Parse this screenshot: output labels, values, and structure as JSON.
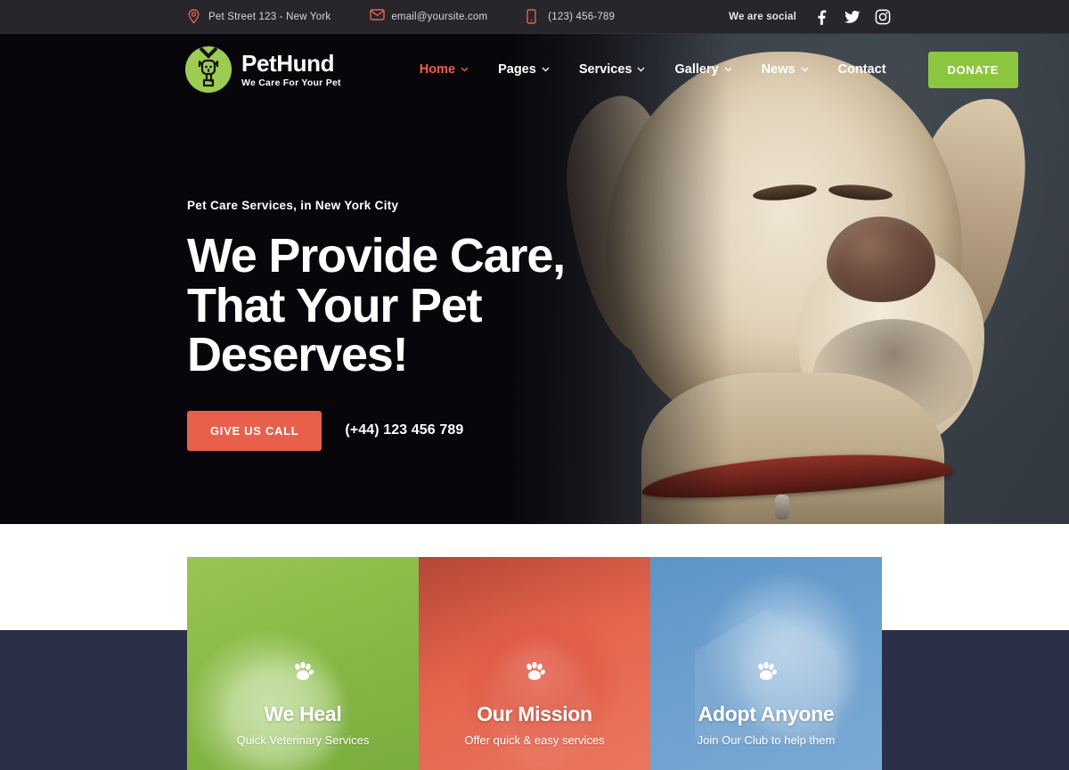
{
  "topbar": {
    "contacts": [
      {
        "icon": "location-pin-icon",
        "text": "Pet Street 123 - New York"
      },
      {
        "icon": "envelope-icon",
        "text": "email@yoursite.com"
      },
      {
        "icon": "mobile-phone-icon",
        "text": "(123) 456-789"
      }
    ],
    "social_label": "We are social",
    "social": [
      {
        "icon": "facebook-icon",
        "name": "Facebook"
      },
      {
        "icon": "twitter-icon",
        "name": "Twitter"
      },
      {
        "icon": "instagram-icon",
        "name": "Instagram"
      }
    ]
  },
  "header": {
    "logo": {
      "name": "PetHund",
      "tagline": "We Care For Your Pet",
      "icon": "dog-badge-icon"
    },
    "nav": [
      {
        "label": "Home",
        "has_dropdown": true,
        "active": true
      },
      {
        "label": "Pages",
        "has_dropdown": true,
        "active": false
      },
      {
        "label": "Services",
        "has_dropdown": true,
        "active": false
      },
      {
        "label": "Gallery",
        "has_dropdown": true,
        "active": false
      },
      {
        "label": "News",
        "has_dropdown": true,
        "active": false
      },
      {
        "label": "Contact",
        "has_dropdown": false,
        "active": false
      }
    ],
    "donate_label": "DONATE"
  },
  "hero": {
    "eyebrow": "Pet Care Services, in New York City",
    "title_line1": "We Provide Care,",
    "title_line2": "That Your Pet",
    "title_line3": "Deserves!",
    "cta_label": "GIVE US CALL",
    "phone": "(+44) 123 456 789"
  },
  "cards": [
    {
      "title": "We Heal",
      "subtitle": "Quick Veterinary Services",
      "icon": "paw-icon",
      "color": "#8cc63f"
    },
    {
      "title": "Our Mission",
      "subtitle": "Offer quick & easy services",
      "icon": "paw-icon",
      "color": "#e8604c"
    },
    {
      "title": "Adopt Anyone",
      "subtitle": "Join Our Club to help them",
      "icon": "paw-icon",
      "color": "#5d94c6",
      "watermark": "Adopt"
    }
  ],
  "colors": {
    "accent_orange": "#e8604c",
    "accent_green": "#8cc63f",
    "accent_blue": "#5d94c6",
    "topbar_bg": "#26262b",
    "hero_bg": "#08060a",
    "navy_band": "#2b3049"
  }
}
